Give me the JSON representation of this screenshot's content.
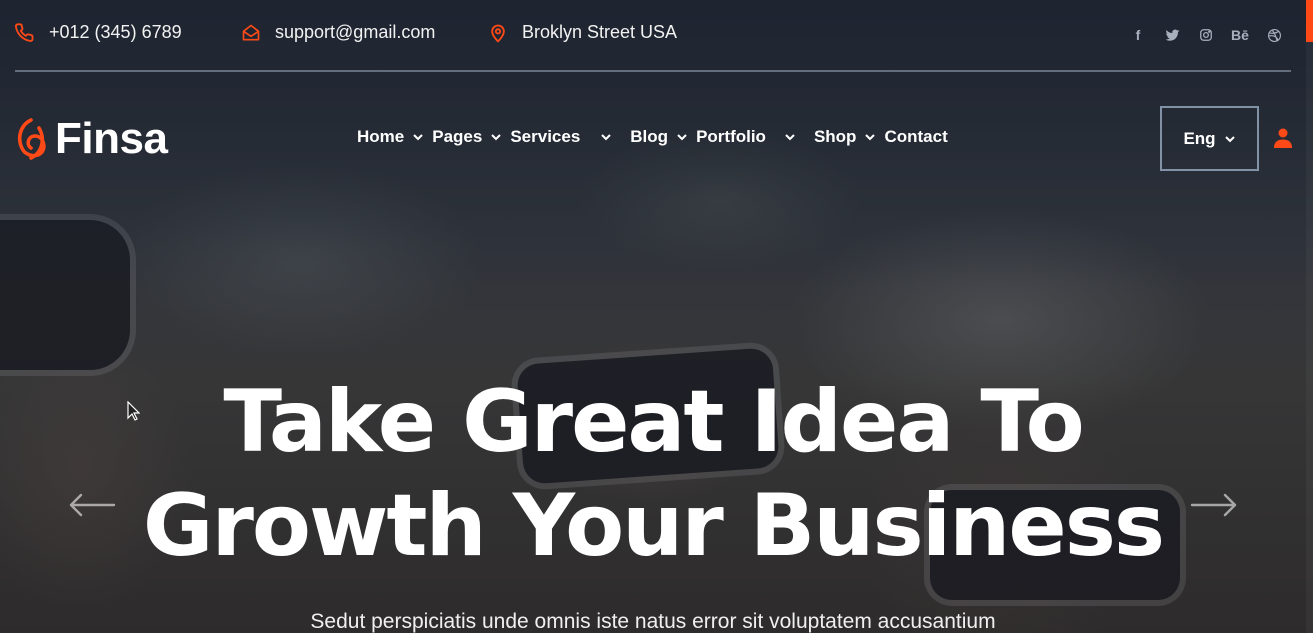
{
  "topbar": {
    "phone": "+012 (345) 6789",
    "email": "support@gmail.com",
    "address": "Broklyn Street USA",
    "socials": [
      {
        "name": "facebook-icon",
        "glyph": "f"
      },
      {
        "name": "twitter-icon",
        "glyph": "t"
      },
      {
        "name": "instagram-icon",
        "glyph": "◎"
      },
      {
        "name": "behance-icon",
        "glyph": "Bē"
      },
      {
        "name": "dribbble-icon",
        "glyph": "◍"
      }
    ]
  },
  "brand": {
    "name": "Finsa",
    "accent": "#ff4a17"
  },
  "nav": {
    "items": [
      {
        "label": "Home",
        "has_dropdown": true
      },
      {
        "label": "Pages",
        "has_dropdown": true
      },
      {
        "label": "Services",
        "has_dropdown": true
      },
      {
        "label": "Blog",
        "has_dropdown": true
      },
      {
        "label": "Portfolio",
        "has_dropdown": true
      },
      {
        "label": "Shop",
        "has_dropdown": true
      },
      {
        "label": "Contact",
        "has_dropdown": false
      }
    ],
    "language": "Eng"
  },
  "hero": {
    "headline_line1": "Take Great Idea To",
    "headline_line2": "Growth Your Business",
    "subtext": "Sedut perspiciatis unde omnis iste natus error sit voluptatem accusantium"
  }
}
